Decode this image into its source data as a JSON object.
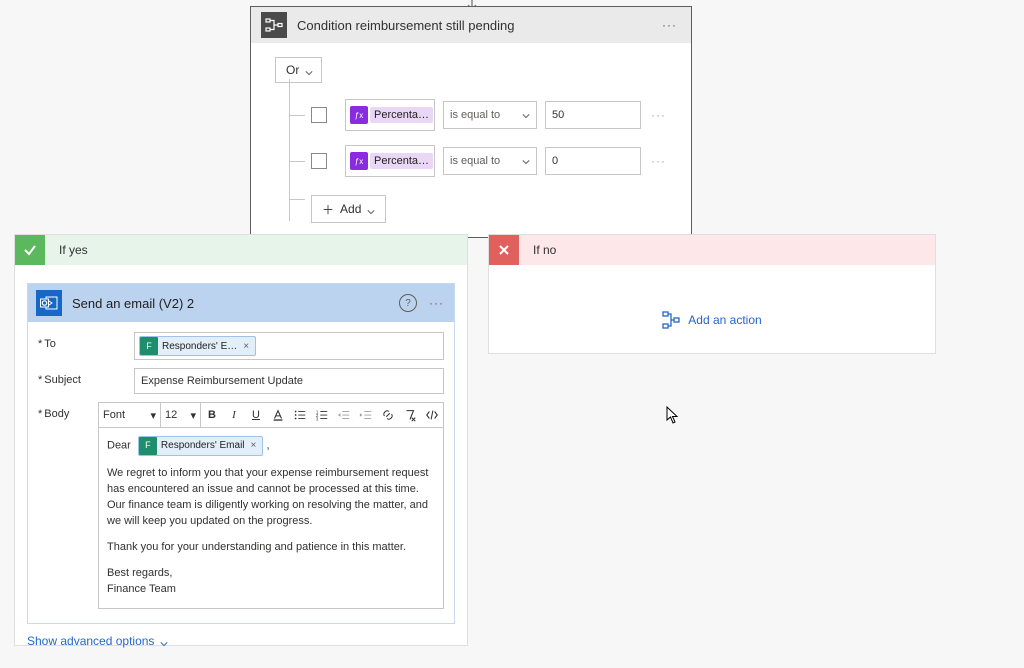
{
  "condition": {
    "title": "Condition reimbursement still pending",
    "group_operator": "Or",
    "add_label": "Add",
    "rows": [
      {
        "field_chip": "Percenta…",
        "operator": "is equal to",
        "value": "50"
      },
      {
        "field_chip": "Percenta…",
        "operator": "is equal to",
        "value": "0"
      }
    ]
  },
  "branches": {
    "yes": {
      "title": "If yes"
    },
    "no": {
      "title": "If no",
      "add_action": "Add an action"
    }
  },
  "email_action": {
    "title": "Send an email (V2) 2",
    "labels": {
      "to": "To",
      "subject": "Subject",
      "body": "Body"
    },
    "to_chip": "Responders' E…",
    "subject": "Expense Reimbursement Update",
    "toolbar": {
      "font": "Font",
      "size": "12"
    },
    "body": {
      "greeting": "Dear",
      "inline_chip": "Responders' Email",
      "p1": "We regret to inform you that your expense reimbursement request has encountered an issue and cannot be processed at this time. Our finance team is diligently working on resolving the matter, and we will keep you updated on the progress.",
      "p2": "Thank you for your understanding and patience in this matter.",
      "sign1": "Best regards,",
      "sign2": "Finance Team"
    },
    "advanced": "Show advanced options"
  }
}
